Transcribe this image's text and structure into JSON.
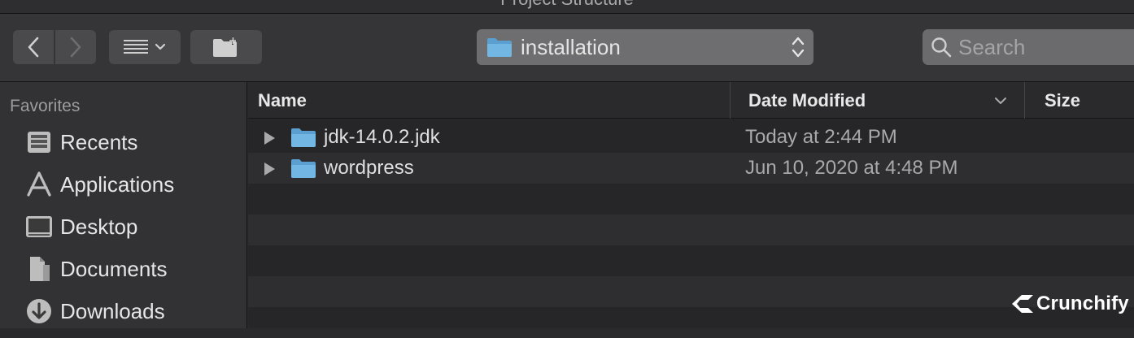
{
  "window": {
    "title": "Project Structure"
  },
  "toolbar": {
    "path": "installation",
    "search_placeholder": "Search"
  },
  "sidebar": {
    "section": "Favorites",
    "items": [
      {
        "label": "Recents",
        "icon": "recents-icon"
      },
      {
        "label": "Applications",
        "icon": "applications-icon"
      },
      {
        "label": "Desktop",
        "icon": "desktop-icon"
      },
      {
        "label": "Documents",
        "icon": "documents-icon"
      },
      {
        "label": "Downloads",
        "icon": "downloads-icon"
      }
    ]
  },
  "columns": {
    "name": "Name",
    "date": "Date Modified",
    "size": "Size"
  },
  "files": [
    {
      "name": "jdk-14.0.2.jdk",
      "date": "Today at 2:44 PM"
    },
    {
      "name": "wordpress",
      "date": "Jun 10, 2020 at 4:48 PM"
    }
  ],
  "brand": {
    "name": "Crunchify"
  },
  "colors": {
    "folder": "#6fb1e0",
    "background": "#262628",
    "accent": "#ffffff"
  }
}
